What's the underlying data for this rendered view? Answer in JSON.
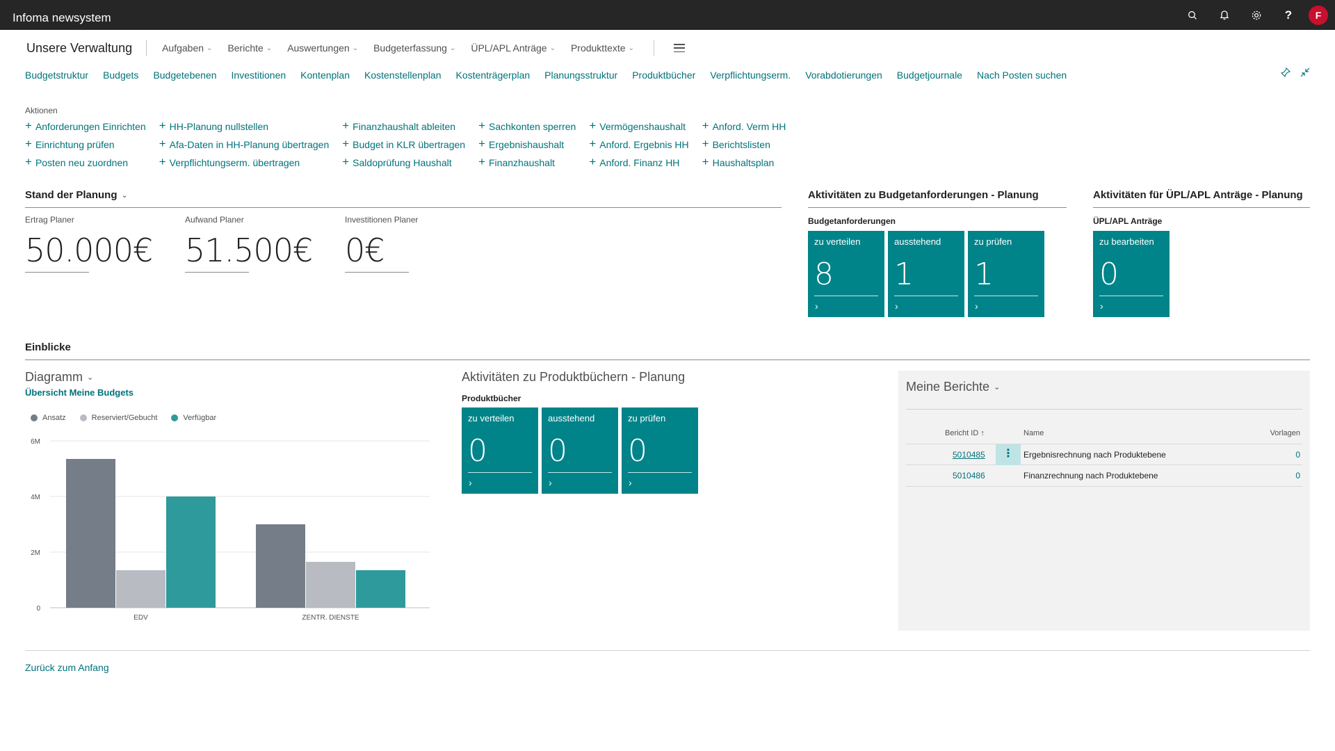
{
  "topbar": {
    "app_title": "Infoma newsystem",
    "avatar_initial": "F"
  },
  "menubar": {
    "company": "Unsere Verwaltung",
    "items": [
      "Aufgaben",
      "Berichte",
      "Auswertungen",
      "Budgeterfassung",
      "ÜPL/APL Anträge",
      "Produkttexte"
    ]
  },
  "navbar": [
    "Budgetstruktur",
    "Budgets",
    "Budgetebenen",
    "Investitionen",
    "Kontenplan",
    "Kostenstellenplan",
    "Kostenträgerplan",
    "Planungsstruktur",
    "Produktbücher",
    "Verpflichtungserm.",
    "Vorabdotierungen",
    "Budgetjournale",
    "Nach Posten suchen"
  ],
  "actions": {
    "title": "Aktionen",
    "col1": [
      "Anforderungen Einrichten",
      "Einrichtung prüfen",
      "Posten neu zuordnen"
    ],
    "col2": [
      "HH-Planung nullstellen",
      "Afa-Daten in HH-Planung übertragen",
      "Verpflichtungserm. übertragen"
    ],
    "col3": [
      "Finanzhaushalt ableiten",
      "Budget in KLR übertragen",
      "Saldoprüfung Haushalt"
    ],
    "col4": [
      "Sachkonten sperren",
      "Ergebnishaushalt",
      "Finanzhaushalt"
    ],
    "col5": [
      "Vermögenshaushalt",
      "Anford. Ergebnis HH",
      "Anford. Finanz HH"
    ],
    "col6": [
      "Anford. Verm HH",
      "Berichtslisten",
      "Haushaltsplan"
    ]
  },
  "stand": {
    "title": "Stand der Planung",
    "kpis": [
      {
        "label": "Ertrag Planer",
        "value": "50.000€"
      },
      {
        "label": "Aufwand Planer",
        "value": "51.500€"
      },
      {
        "label": "Investitionen Planer",
        "value": "0€"
      }
    ]
  },
  "budget_cues": {
    "title": "Aktivitäten zu Budgetanforderungen - Planung",
    "sub": "Budgetanforderungen",
    "tiles": [
      {
        "label": "zu verteilen",
        "value": "8"
      },
      {
        "label": "ausstehend",
        "value": "1"
      },
      {
        "label": "zu prüfen",
        "value": "1"
      }
    ]
  },
  "upl_cues": {
    "title": "Aktivitäten für ÜPL/APL Anträge - Planung",
    "sub": "ÜPL/APL Anträge",
    "tiles": [
      {
        "label": "zu bearbeiten",
        "value": "0"
      }
    ]
  },
  "einblicke": {
    "title": "Einblicke"
  },
  "diagram": {
    "title": "Diagramm",
    "subtitle": "Übersicht Meine Budgets"
  },
  "chart_data": {
    "type": "bar",
    "categories": [
      "EDV",
      "ZENTR. DIENSTE"
    ],
    "series": [
      {
        "name": "Ansatz",
        "values": [
          5350000,
          3000000
        ],
        "color": "#747d88"
      },
      {
        "name": "Reserviert/Gebucht",
        "values": [
          1350000,
          1650000
        ],
        "color": "#b8bcc2"
      },
      {
        "name": "Verfügbar",
        "values": [
          4000000,
          1350000
        ],
        "color": "#2e9a9c"
      }
    ],
    "yticks": [
      "0",
      "2M",
      "4M",
      "6M"
    ],
    "ylim": [
      0,
      6000000
    ]
  },
  "prod_cues": {
    "title": "Aktivitäten zu Produktbüchern - Planung",
    "sub": "Produktbücher",
    "tiles": [
      {
        "label": "zu verteilen",
        "value": "0"
      },
      {
        "label": "ausstehend",
        "value": "0"
      },
      {
        "label": "zu prüfen",
        "value": "0"
      }
    ]
  },
  "reports": {
    "title": "Meine Berichte",
    "headers": {
      "id": "Bericht ID ↑",
      "name": "Name",
      "count": "Vorlagen"
    },
    "rows": [
      {
        "id": "5010485",
        "name": "Ergebnisrechnung nach Produktebene",
        "count": "0"
      },
      {
        "id": "5010486",
        "name": "Finanzrechnung nach Produktebene",
        "count": "0"
      }
    ]
  },
  "footer": {
    "back_link": "Zurück zum Anfang"
  }
}
